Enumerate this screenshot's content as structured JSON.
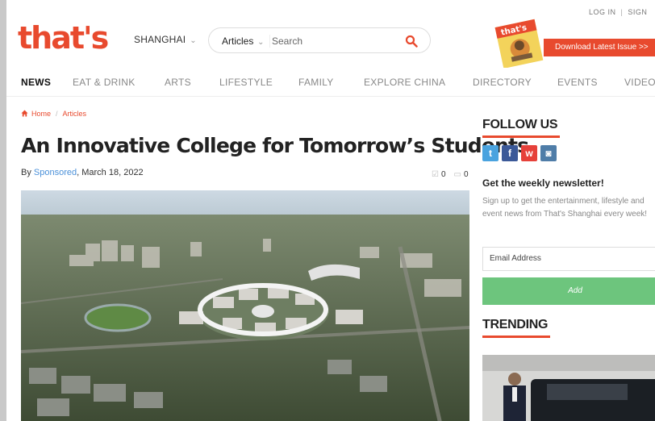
{
  "header": {
    "logo_text": "that's",
    "city": "SHANGHAI",
    "search_category": "Articles",
    "search_placeholder": "Search",
    "login": "LOG IN",
    "signup": "SIGN",
    "magazine_label": "that's",
    "download": "Download Latest Issue >>"
  },
  "nav": {
    "items": [
      "NEWS",
      "EAT & DRINK",
      "ARTS",
      "LIFESTYLE",
      "FAMILY",
      "EXPLORE CHINA",
      "DIRECTORY",
      "EVENTS",
      "VIDEO"
    ]
  },
  "breadcrumb": {
    "home": "Home",
    "current": "Articles"
  },
  "article": {
    "title": "An Innovative College for Tomorrow’s Students",
    "by": "By ",
    "author": "Sponsored",
    "date": ", March 18, 2022",
    "likes": "0",
    "comments": "0"
  },
  "sidebar": {
    "follow_heading": "FOLLOW US",
    "social": [
      "twitter-icon",
      "facebook-icon",
      "weibo-icon",
      "instagram-icon"
    ],
    "newsletter_title": "Get the weekly newsletter!",
    "newsletter_text": "Sign up to get the entertainment, lifestyle and event news from That's Shanghai every week!",
    "email_placeholder": "Email Address",
    "add_label": "Add",
    "trending_heading": "TRENDING"
  },
  "colors": {
    "brand": "#e84a2e",
    "link": "#4a90d9",
    "add": "#6dc57d"
  }
}
